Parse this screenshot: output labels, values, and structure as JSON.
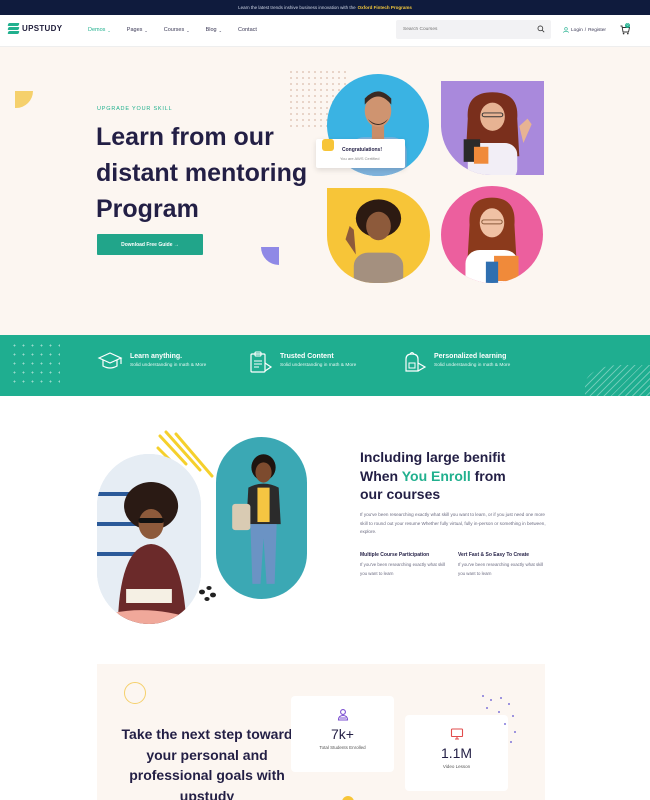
{
  "announcement": {
    "text": "Learn the latest trends inshive business innovation with the",
    "highlight": "Oxford Fintech Programs"
  },
  "brand": {
    "name": "UPSTUDY",
    "color": "#21b08e"
  },
  "nav": {
    "items": [
      {
        "label": "Demos",
        "chevron": true,
        "active": true
      },
      {
        "label": "Pages",
        "chevron": true
      },
      {
        "label": "Courses",
        "chevron": true
      },
      {
        "label": "Blog",
        "chevron": true
      },
      {
        "label": "Contact",
        "chevron": false
      }
    ],
    "search_placeholder": "Search Courses",
    "login": "Login",
    "separator": "/",
    "register": "Register",
    "cart_count": "0"
  },
  "hero": {
    "kicker": "UPGRADE YOUR SKILL",
    "title": "Learn from our distant mentoring Program",
    "cta": "Download Free Guide →",
    "congrats_title": "Congratulations!",
    "congrats_sub": "You are AWS Certified"
  },
  "features": [
    {
      "title": "Learn anything.",
      "subtitle": "Solid understanding in math & More",
      "icon": "graduation-cap-icon"
    },
    {
      "title": "Trusted Content",
      "subtitle": "Solid understanding in math & More",
      "icon": "clipboard-icon"
    },
    {
      "title": "Personalized learning",
      "subtitle": "Solid understanding in math & More",
      "icon": "backpack-icon"
    }
  ],
  "benefit": {
    "title_line1": "Including large benifit",
    "title_pre": "When ",
    "title_accent": "You Enroll",
    "title_post": " from",
    "title_line3": "our courses",
    "description": "If you've been researching exactly what skill you want to learn, or if you just need one more skill to round out your resume Whether fully virtual, fully in-person or something in between, explore.",
    "perks": [
      {
        "title": "Multiple Course Participation",
        "text": "If you've been researching exactly what skill you want to learn"
      },
      {
        "title": "Vert Fast & So Easy To Create",
        "text": "If you've been researching exactly what skill you want to learn"
      }
    ]
  },
  "stats": {
    "title": "Take the next step toward your personal and professional goals with upstudy",
    "cards": [
      {
        "value": "7k+",
        "label": "Total Students Enrolled",
        "icon": "users-icon"
      },
      {
        "value": "1.1M",
        "label": "Video Lesson",
        "icon": "monitor-icon"
      }
    ]
  },
  "colors": {
    "accent": "#21b08e",
    "dark": "#231f45",
    "hero_bg": "#fcf6f1",
    "band": "#1fae90"
  }
}
